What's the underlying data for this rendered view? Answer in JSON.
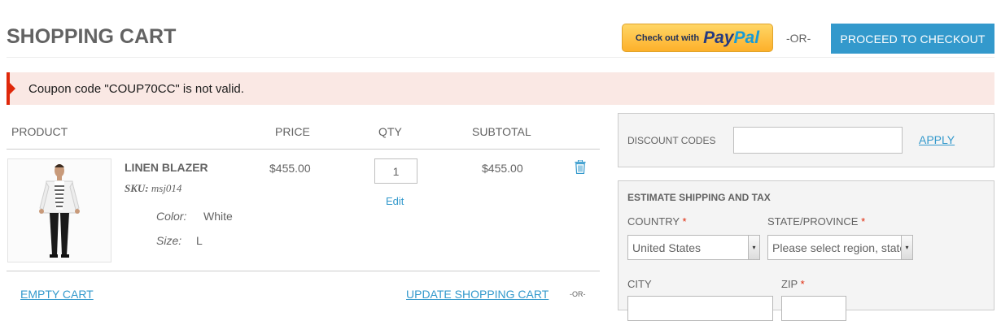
{
  "header": {
    "title": "SHOPPING CART",
    "paypal": {
      "small_text": "Check out with",
      "pay": "Pay",
      "pal": "Pal"
    },
    "or_text": "-OR-",
    "checkout_label": "PROCEED TO CHECKOUT"
  },
  "message": {
    "error": "Coupon code \"COUP70CC\" is not valid."
  },
  "cart": {
    "columns": {
      "product": "PRODUCT",
      "price": "PRICE",
      "qty": "QTY",
      "subtotal": "SUBTOTAL"
    },
    "items": [
      {
        "name": "LINEN BLAZER",
        "sku_label": "SKU:",
        "sku": "msj014",
        "options": [
          {
            "label": "Color:",
            "value": "White"
          },
          {
            "label": "Size:",
            "value": "L"
          }
        ],
        "price": "$455.00",
        "qty": "1",
        "edit_label": "Edit",
        "subtotal": "$455.00"
      }
    ],
    "empty_label": "EMPTY CART",
    "update_label": "UPDATE SHOPPING CART",
    "or_small": "-OR-"
  },
  "discount": {
    "label": "DISCOUNT CODES",
    "input_value": "",
    "apply_label": "APPLY"
  },
  "shipping": {
    "title": "ESTIMATE SHIPPING AND TAX",
    "country_label": "COUNTRY",
    "country_value": "United States",
    "state_label": "STATE/PROVINCE",
    "state_value": "Please select region, state or province",
    "city_label": "CITY",
    "zip_label": "ZIP",
    "required_mark": "*"
  },
  "colors": {
    "accent": "#3399cc",
    "error": "#df280a",
    "error_bg": "#fae8e4",
    "text": "#636363"
  },
  "icons": {
    "trash": "trash-icon",
    "select_arrow": "chevron-down-icon"
  }
}
